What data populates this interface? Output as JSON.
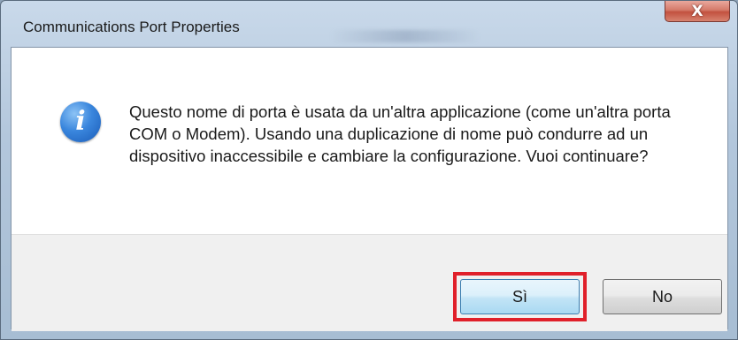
{
  "window": {
    "title": "Communications Port Properties",
    "close_label": "X"
  },
  "dialog": {
    "icon": "info-icon",
    "message": "Questo nome di porta è usata da un'altra applicazione (come un'altra porta COM o Modem). Usando una duplicazione di nome può condurre ad un dispositivo inaccessibile e cambiare la configurazione. Vuoi continuare?",
    "buttons": {
      "yes_label": "Sì",
      "no_label": "No"
    },
    "highlighted_button": "yes"
  },
  "colors": {
    "highlight": "#e0202a",
    "icon_blue": "#3a86dd"
  }
}
